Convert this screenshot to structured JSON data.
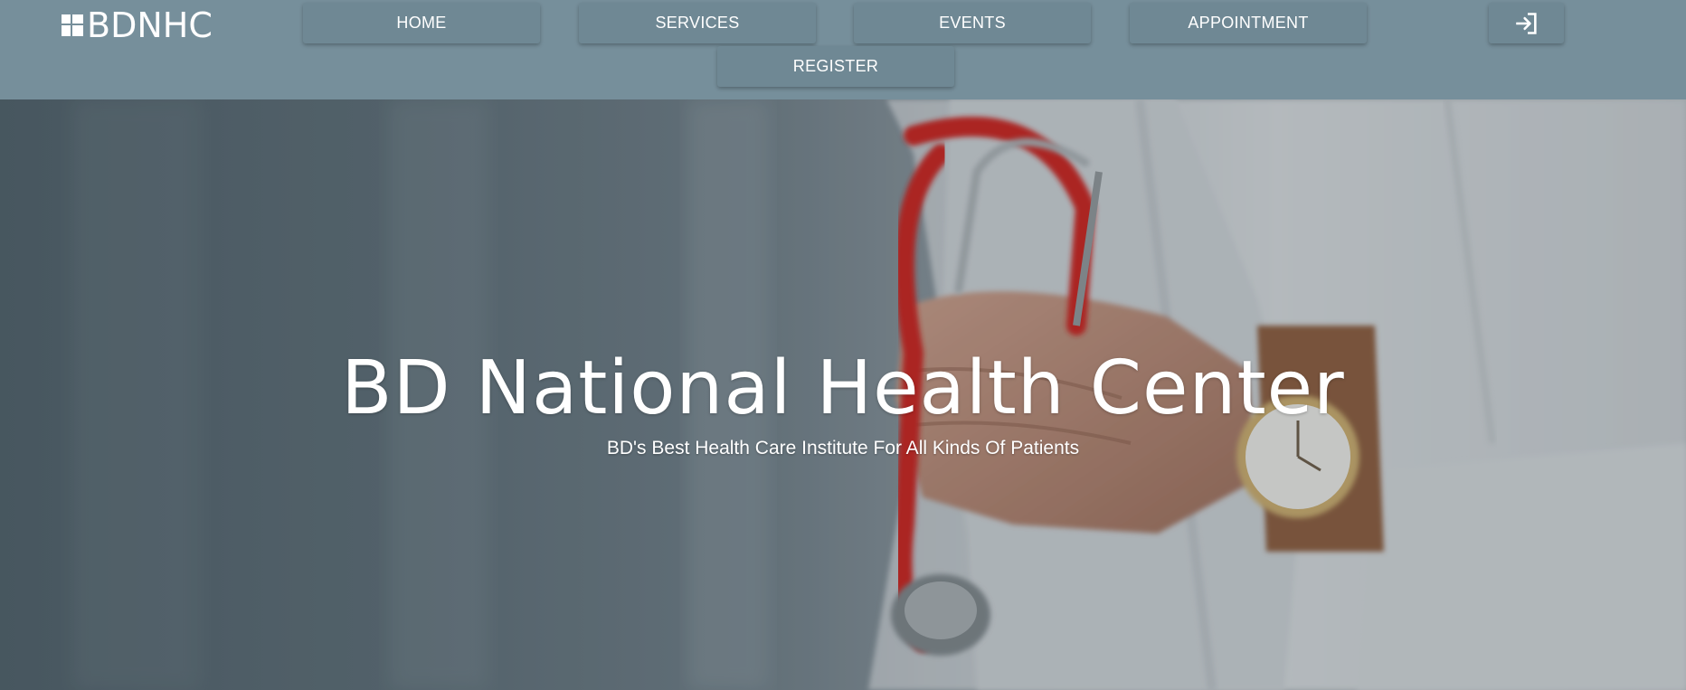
{
  "brand": {
    "name": "BDNHC"
  },
  "nav": {
    "home": "HOME",
    "services": "SERVICES",
    "events": "EVENTS",
    "appointment": "APPOINTMENT",
    "register": "REGISTER",
    "login_icon": "login-icon"
  },
  "hero": {
    "title": "BD National Health Center",
    "subtitle": "BD's Best Health Care Institute For All Kinds Of Patients",
    "image": "doctor-with-stethoscope-photo"
  },
  "colors": {
    "header_bg": "#768f9b",
    "button_bg": "#6f8894",
    "text": "#ffffff",
    "stethoscope": "#c8211a"
  }
}
